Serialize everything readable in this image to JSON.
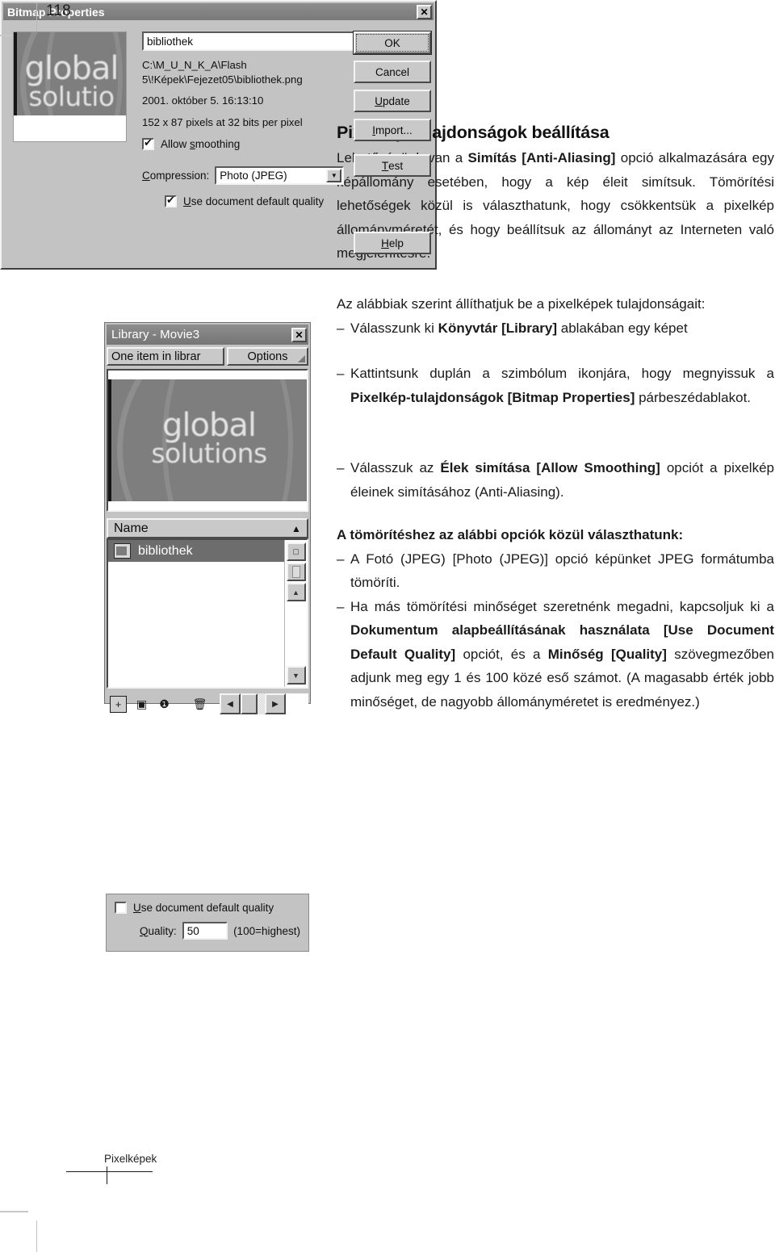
{
  "page": {
    "number": "118",
    "footer_label": "Pixelképek"
  },
  "article": {
    "title": "Pixelkép-tulajdonságok beállítása",
    "intro_parts": {
      "p1": "Lehetőségünk van a ",
      "b1": "Simítás [Anti-Aliasing]",
      "p2": " opció alkalmazására egy képállomány esetében, hogy a kép éleit simítsuk. Tömörítési lehetőségek közül is választhatunk, hogy csökkentsük a pixelkép állományméretét, és hogy beállítsuk az állományt az Interneten való megjelenítésre."
    },
    "lead_in": "Az alábbiak szerint állíthatjuk be a pixelképek tulajdonságait:",
    "dash": "–",
    "step1": {
      "p1": "Válasszunk ki ",
      "b1": "Könyvtár [Library]",
      "p2": " ablakában egy képet"
    },
    "step2": {
      "p1": "Kattintsunk duplán a szimbólum ikonjára, hogy megnyissuk a ",
      "b1": "Pixelkép-tulajdonságok [Bitmap Properties]",
      "p2": " párbeszédablakot."
    },
    "step3": {
      "p1": "Válasszuk az ",
      "b1": "Élek simítása [Allow Smoothing]",
      "p2": " opciót a pixelkép éleinek simításához (Anti-Aliasing)."
    },
    "compression_heading": "A tömörítéshez az alábbi opciók közül választhatunk:",
    "step4": "A Fotó (JPEG) [Photo (JPEG)] opció képünket JPEG formátumba tömöríti.",
    "step5": {
      "p1": "Ha más tömörítési minőséget szeretnénk megadni, kapcsoljuk ki a ",
      "b1": "Dokumentum alapbeállításának használata [Use Document Default Quality]",
      "p2": " opciót, és a ",
      "b2": "Minőség [Quality]",
      "p3": " szövegmezőben adjunk meg egy 1 és 100 közé eső számot. (A magasabb érték jobb minőséget, de nagyobb állományméretet is eredményez.)"
    }
  },
  "library_window": {
    "title": "Library - Movie3",
    "close_glyph": "✕",
    "item_count": "One item in librar",
    "options_label": "Options",
    "column_name": "Name",
    "sort_glyph": "▲",
    "items": [
      {
        "label": "bibliothek"
      }
    ],
    "preview_brand_line1": "global",
    "preview_brand_line2": "solutions",
    "toolbar_icons": {
      "new_symbol": "+",
      "new_folder": "▣",
      "properties": "❶",
      "delete": "🗑",
      "scroll_left": "◀",
      "scroll_right": "▶"
    },
    "scroll": {
      "up_glyph": "▲",
      "down_glyph": "▼"
    }
  },
  "quality_panel": {
    "use_default_label_u": "U",
    "use_default_label_rest": "se document default quality",
    "use_default_checked": false,
    "quality_label_u": "Q",
    "quality_label_rest": "uality:",
    "quality_value": "50",
    "quality_hint": "(100=highest)"
  },
  "bitmap_dialog": {
    "title": "Bitmap Properties",
    "close_glyph": "✕",
    "name_value": "bibliothek",
    "path_line1": "C:\\M_U_N_K_A\\Flash",
    "path_line2": "5\\!Képek\\Fejezet05\\bibliothek.png",
    "date_line": "2001. október 5.  16:13:10",
    "dims_line": "152 x 87 pixels at 32 bits per pixel",
    "allow_smoothing_u": "s",
    "allow_smoothing_pre": "Allow ",
    "allow_smoothing_post": "moothing",
    "allow_smoothing_checked": true,
    "compression_label_u": "C",
    "compression_label_rest": "ompression:",
    "compression_value": "Photo (JPEG)",
    "combo_arrow": "▼",
    "use_default_pre": "",
    "use_default_u": "U",
    "use_default_rest": "se document default quality",
    "use_default_checked": true,
    "preview_brand_line1": "global",
    "preview_brand_line2": "solutio",
    "buttons": {
      "ok": "OK",
      "cancel": "Cancel",
      "update_u": "U",
      "update_rest": "pdate",
      "import_u": "I",
      "import_rest": "mport...",
      "test_u": "T",
      "test_rest": "est",
      "help_u": "H",
      "help_rest": "elp"
    }
  }
}
